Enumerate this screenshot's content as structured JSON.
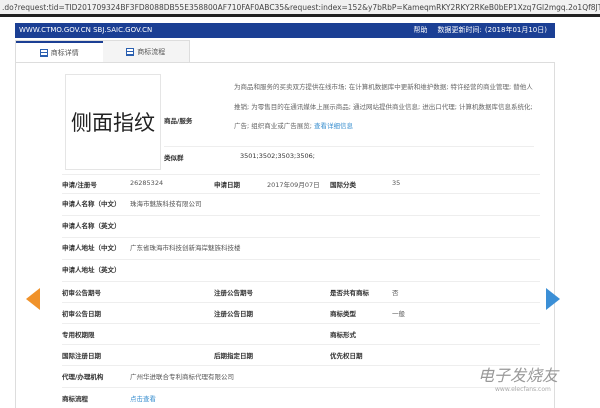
{
  "url": ".do?request:tid=TID201709324BF3FD8088DB55E358800AF710FAF0ABC35&request:index=152&y7bRbP=KameqmRKY2RKY2RKeB0bEP1Xzq7Gl2mgq.2o1Qf8JT3",
  "header": {
    "site": "WWW.CTMO.GOV.CN SBJ.SAIC.GOV.CN",
    "help": "帮助",
    "update_label": "数据更新时间:",
    "update_date": "(2018年01月10日)"
  },
  "tabs": [
    {
      "label": "商标详情"
    },
    {
      "label": "商标流程"
    }
  ],
  "mark_text": "侧面指纹",
  "goods_label": "商品/服务",
  "goods_text": "为商品和服务的买卖双方提供在线市场; 在计算机数据库中更新和维护数据; 特许经营的商业管理; 替他人推销; 为零售目的在通讯媒体上展示商品; 通过网站提供商业信息; 进出口代理; 计算机数据库信息系统化; 广告; 组织商业或广告展览;",
  "goods_link": "查看详细信息",
  "similar_label": "类似群",
  "similar_value": "3501;3502;3503;3506;",
  "rows": {
    "reg_no": {
      "label": "申请/注册号",
      "value": "26285324"
    },
    "app_date": {
      "label": "申请日期",
      "value": "2017年09月07日"
    },
    "intl_class": {
      "label": "国际分类",
      "value": "35"
    },
    "name_cn": {
      "label": "申请人名称（中文）",
      "value": "珠海市魅族科技有限公司"
    },
    "name_en": {
      "label": "申请人名称（英文）"
    },
    "addr_cn": {
      "label": "申请人地址（中文）",
      "value": "广东省珠海市科技创新海岸魅族科技楼"
    },
    "addr_en": {
      "label": "申请人地址（英文）"
    },
    "prelim_no": {
      "label": "初审公告期号"
    },
    "reg_pub_no": {
      "label": "注册公告期号"
    },
    "shared": {
      "label": "是否共有商标",
      "value": "否"
    },
    "prelim_date": {
      "label": "初审公告日期"
    },
    "reg_pub_date": {
      "label": "注册公告日期"
    },
    "mark_type": {
      "label": "商标类型",
      "value": "一般"
    },
    "exclusive": {
      "label": "专用权期限"
    },
    "mark_form": {
      "label": "商标形式"
    },
    "intl_reg_date": {
      "label": "国际注册日期"
    },
    "later_date": {
      "label": "后期指定日期"
    },
    "priority_date": {
      "label": "优先权日期"
    },
    "agent": {
      "label": "代理/办理机构",
      "value": "广州华进联合专利商标代理有限公司"
    },
    "flow": {
      "label": "商标流程",
      "value": "点击查看"
    }
  },
  "watermark": {
    "text": "电子发烧友",
    "url": "www.elecfans.com"
  }
}
